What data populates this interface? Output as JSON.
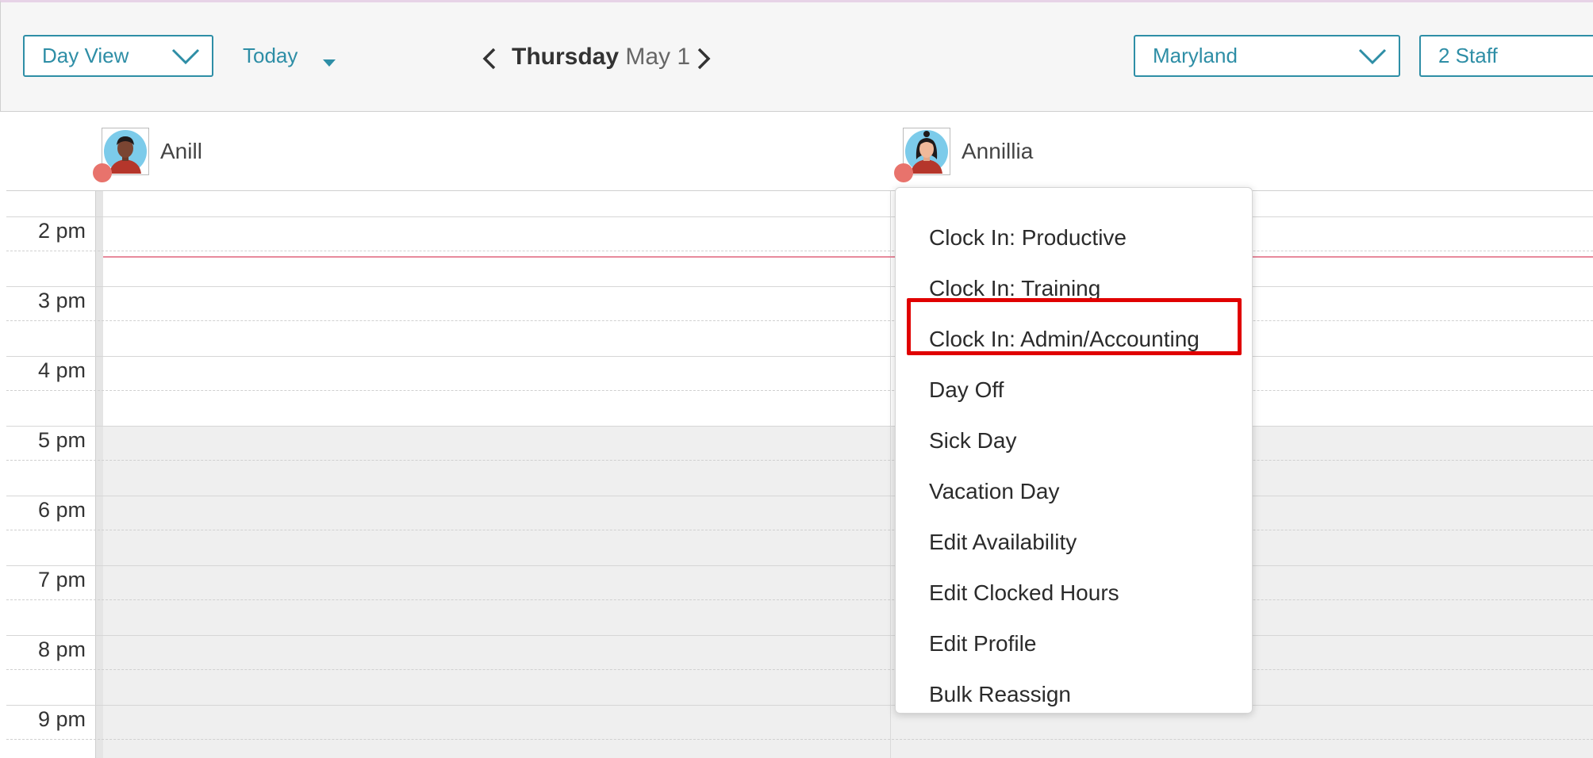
{
  "toolbar": {
    "view_select": "Day View",
    "today_label": "Today",
    "day_name": "Thursday",
    "date": "May 1",
    "location_select": "Maryland",
    "staff_select": "2 Staff"
  },
  "staff": [
    {
      "name": "Anill"
    },
    {
      "name": "Annillia"
    }
  ],
  "hours": [
    "2 pm",
    "3 pm",
    "4 pm",
    "5 pm",
    "6 pm",
    "7 pm",
    "8 pm",
    "9 pm"
  ],
  "context_menu": {
    "items": [
      "Clock In: Productive",
      "Clock In: Training",
      "Clock In: Admin/Accounting",
      "Day Off",
      "Sick Day",
      "Vacation Day",
      "Edit Availability",
      "Edit Clocked Hours",
      "Edit Profile",
      "Bulk Reassign"
    ],
    "highlighted_item": "Clock In: Admin/Accounting"
  },
  "colors": {
    "accent": "#2e8ea6",
    "status_dot": "#e8736c",
    "now_line": "#e88a9c",
    "highlight_border": "#e00000"
  }
}
